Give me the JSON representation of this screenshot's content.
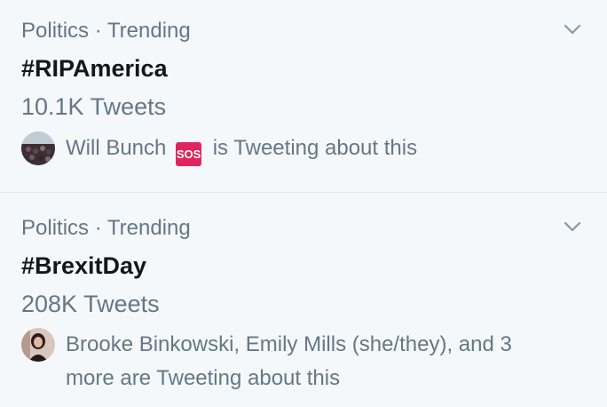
{
  "colors": {
    "background": "#f5f8fa",
    "divider": "#e1e8ed",
    "secondary_text": "#657786",
    "primary_text": "#14171a",
    "sos_badge": "#e0245e"
  },
  "trends": [
    {
      "context": "Politics · Trending",
      "topic": "#RIPAmerica",
      "count": "10.1K Tweets",
      "more_icon": "chevron-down-icon",
      "social": {
        "avatar_icon": "user-avatar",
        "names": "Will Bunch",
        "emoji": "SOS",
        "suffix": "is Tweeting about this"
      }
    },
    {
      "context": "Politics · Trending",
      "topic": "#BrexitDay",
      "count": "208K Tweets",
      "more_icon": "chevron-down-icon",
      "social": {
        "avatar_icon": "user-avatar",
        "text": "Brooke Binkowski, Emily Mills (she/they), and 3 more are Tweeting about this"
      }
    }
  ]
}
